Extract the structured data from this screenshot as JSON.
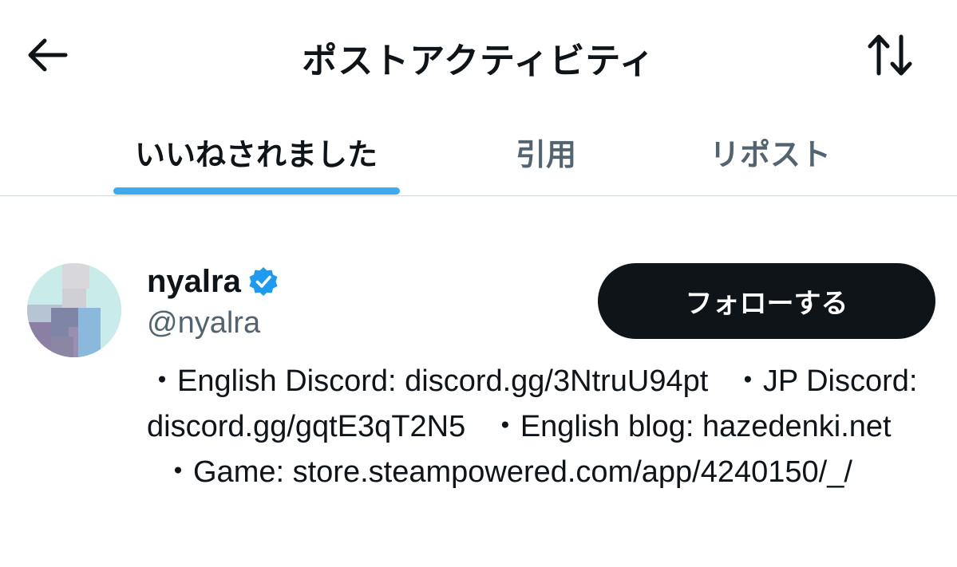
{
  "header": {
    "title": "ポストアクティビティ",
    "back_icon": "arrow-left-icon",
    "sort_icon": "sort-arrows-icon"
  },
  "tabs": [
    {
      "label": "いいねされました",
      "active": true
    },
    {
      "label": "引用",
      "active": false
    },
    {
      "label": "リポスト",
      "active": false
    }
  ],
  "user": {
    "display_name": "nyalra",
    "handle": "@nyalra",
    "verified": true,
    "verified_color": "#1d9bf0",
    "follow_label": "フォローする",
    "bio": {
      "item1": "・English Discord: discord.gg/3NtruU94pt",
      "item2": "・JP Discord: discord.gg/gqtE3qT2N5",
      "item3": "・English blog: hazedenki.net",
      "item4": "・Game: store.steampowered.com/app/4240150/_/"
    }
  },
  "colors": {
    "accent": "#1d9bf0",
    "text_primary": "#0f1419",
    "text_secondary": "#536471",
    "button_dark": "#0f1419"
  }
}
